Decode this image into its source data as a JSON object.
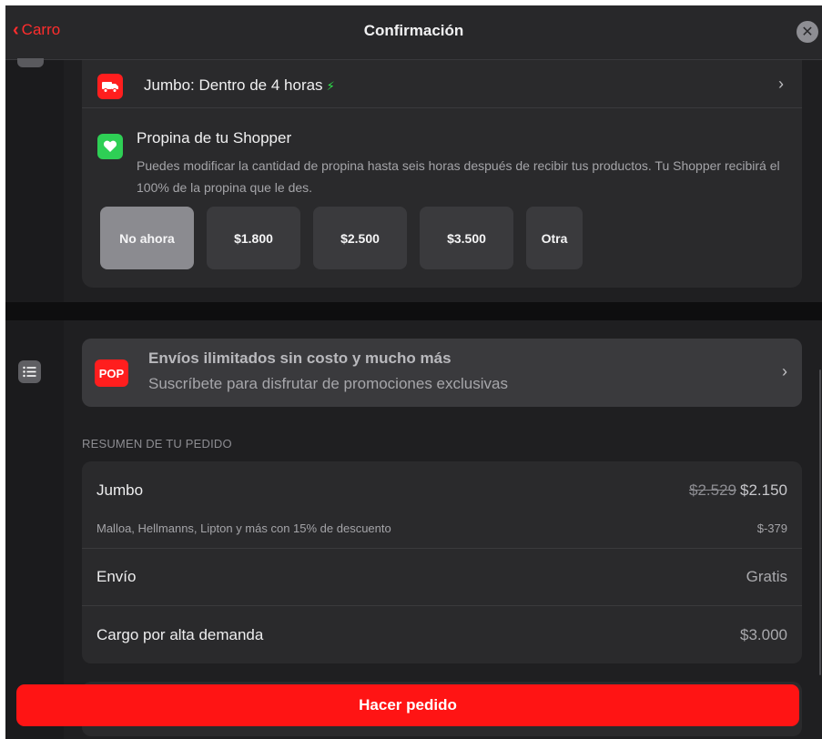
{
  "header": {
    "back_label": "Carro",
    "title": "Confirmación",
    "close_glyph": "✕"
  },
  "delivery": {
    "label": "Jumbo: Dentro de 4 horas",
    "bolt_glyph": "⚡",
    "chevron": "›",
    "icon": "truck-icon"
  },
  "tip": {
    "title": "Propina de tu Shopper",
    "description": "Puedes modificar la cantidad de propina hasta seis horas después de recibir tus productos. Tu Shopper recibirá el 100% de la propina que le des.",
    "icon": "heart-icon",
    "options": [
      {
        "label": "No ahora",
        "selected": true
      },
      {
        "label": "$1.800",
        "selected": false
      },
      {
        "label": "$2.500",
        "selected": false
      },
      {
        "label": "$3.500",
        "selected": false
      },
      {
        "label": "Otra",
        "selected": false
      }
    ]
  },
  "promo": {
    "icon_text": "POP",
    "title": "Envíos ilimitados sin costo y mucho más",
    "subtitle": "Suscríbete para disfrutar de promociones exclusivas",
    "chevron": "›"
  },
  "summary": {
    "heading": "RESUMEN DE TU PEDIDO",
    "store": {
      "label": "Jumbo",
      "old_price": "$2.529",
      "price": "$2.150"
    },
    "discount": {
      "label": "Malloa, Hellmanns, Lipton y más con 15% de descuento",
      "value": "$-379"
    },
    "shipping": {
      "label": "Envío",
      "value": "Gratis"
    },
    "demand": {
      "label": "Cargo por alta demanda",
      "value": "$3.000"
    }
  },
  "order_button": {
    "label": "Hacer pedido"
  },
  "colors": {
    "accent": "#ff1414",
    "background": "#1e1e20",
    "card": "#2a2a2c",
    "tip_selected": "#8b8b90",
    "heart_green": "#2ecf55"
  }
}
